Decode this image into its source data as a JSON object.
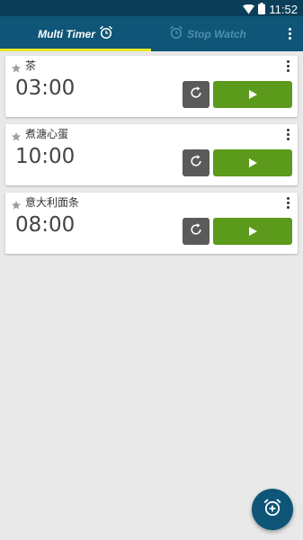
{
  "status_bar": {
    "time": "11:52"
  },
  "tabs": [
    {
      "label": "Multi Timer",
      "icon": "alarm-clock-icon",
      "selected": true
    },
    {
      "label": "Stop Watch",
      "icon": "alarm-clock-icon",
      "selected": false
    }
  ],
  "colors": {
    "app_bar": "#0e5577",
    "status_bar": "#0b3f59",
    "tab_indicator": "#e7e62b",
    "play_button": "#5c9a1c",
    "reset_button": "#5a5a5a",
    "background": "#e9e9e9"
  },
  "timers": [
    {
      "name": "茶",
      "time": "03:00"
    },
    {
      "name": "煮溏心蛋",
      "time": "10:00"
    },
    {
      "name": "意大利面条",
      "time": "08:00"
    }
  ],
  "fab": {
    "icon": "add-alarm-icon"
  }
}
